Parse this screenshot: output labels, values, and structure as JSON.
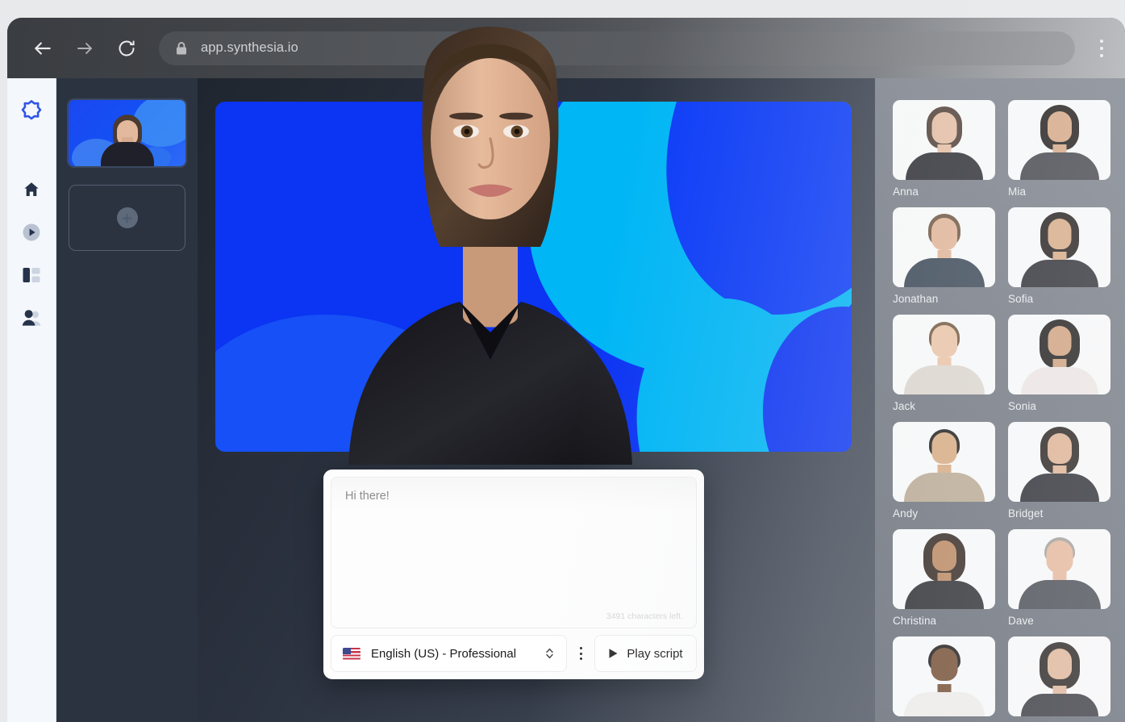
{
  "browser": {
    "url": "app.synthesia.io",
    "back_label": "Back",
    "forward_label": "Forward",
    "reload_label": "Reload",
    "menu_label": "Customize and control",
    "lock_icon": "lock-icon"
  },
  "rail": {
    "logo_name": "synthesia-logo",
    "items": [
      {
        "name": "home",
        "icon": "home-icon"
      },
      {
        "name": "videos",
        "icon": "play-circle-icon"
      },
      {
        "name": "templates",
        "icon": "layout-icon"
      },
      {
        "name": "avatars",
        "icon": "people-icon"
      }
    ]
  },
  "scenes": {
    "panel_name": "Scenes",
    "thumbnail_label": "Scene 1",
    "add_label": "Add scene",
    "add_icon": "plus-icon"
  },
  "canvas": {
    "name": "video-canvas",
    "background_color": "#0b34f3",
    "accent_color": "#00b6f5"
  },
  "script": {
    "text": "Hi there!",
    "placeholder": "Hi there!",
    "characters_left": "3491 characters left.",
    "language": "English (US) - Professional",
    "language_flag": "us-flag",
    "more_label": "More options",
    "play_label": "Play script",
    "play_icon": "play-icon",
    "selector_icon": "chevron-updown-icon"
  },
  "gallery": {
    "panel_name": "Avatars",
    "avatars": [
      {
        "name": "Anna",
        "hair": "#4a382e",
        "hair_w": 44,
        "hair_h": 52,
        "hair_t": 8,
        "face": "#e7bda0",
        "face_w": 31,
        "face_h": 39,
        "face_t": 15,
        "body": "#26262c",
        "body_w": 96,
        "body_h": 34,
        "style": "v-neck"
      },
      {
        "name": "Mia",
        "hair": "#15100d",
        "hair_w": 48,
        "hair_h": 56,
        "hair_t": 6,
        "face": "#d7a47e",
        "face_w": 30,
        "face_h": 38,
        "face_t": 14,
        "body": "#3b3b42",
        "body_w": 98,
        "body_h": 34,
        "style": "red-top"
      },
      {
        "name": "Jonathan",
        "hair": "#6a513c",
        "hair_w": 40,
        "hair_h": 40,
        "hair_t": 8,
        "face": "#e3b393",
        "face_w": 32,
        "face_h": 40,
        "face_t": 13,
        "body": "#33404f",
        "body_w": 100,
        "body_h": 36,
        "style": "white-tee"
      },
      {
        "name": "Sofia",
        "hair": "#191310",
        "hair_w": 48,
        "hair_h": 58,
        "hair_t": 6,
        "face": "#d8a87f",
        "face_w": 29,
        "face_h": 38,
        "face_t": 14,
        "body": "#232329",
        "body_w": 96,
        "body_h": 34,
        "style": "dark"
      },
      {
        "name": "Jack",
        "hair": "#6d5336",
        "hair_w": 38,
        "hair_h": 36,
        "hair_t": 9,
        "face": "#ecc3a3",
        "face_w": 32,
        "face_h": 40,
        "face_t": 13,
        "body": "#ddd6cd",
        "body_w": 100,
        "body_h": 36,
        "style": "light-tee"
      },
      {
        "name": "Sonia",
        "hair": "#130f0d",
        "hair_w": 50,
        "hair_h": 60,
        "hair_t": 6,
        "face": "#cf9d76",
        "face_w": 29,
        "face_h": 37,
        "face_t": 14,
        "body": "#efe7e4",
        "body_w": 96,
        "body_h": 34,
        "style": "white-shirt"
      },
      {
        "name": "Andy",
        "hair": "#151210",
        "hair_w": 38,
        "hair_h": 36,
        "hair_t": 9,
        "face": "#d9a87c",
        "face_w": 31,
        "face_h": 39,
        "face_t": 13,
        "body": "#b9a78f",
        "body_w": 100,
        "body_h": 36,
        "style": "blazer-dark"
      },
      {
        "name": "Bridget",
        "hair": "#1b1410",
        "hair_w": 48,
        "hair_h": 58,
        "hair_t": 6,
        "face": "#dfae8c",
        "face_w": 30,
        "face_h": 38,
        "face_t": 14,
        "body": "#1f1f26",
        "body_w": 98,
        "body_h": 35,
        "style": "dark"
      },
      {
        "name": "Christina",
        "hair": "#2b1d16",
        "hair_w": 52,
        "hair_h": 60,
        "hair_t": 5,
        "face": "#b98257",
        "face_w": 30,
        "face_h": 38,
        "face_t": 14,
        "body": "#232326",
        "body_w": 98,
        "body_h": 35,
        "style": "turtleneck"
      },
      {
        "name": "Dave",
        "hair": "#9d9a93",
        "hair_w": 38,
        "hair_h": 32,
        "hair_t": 10,
        "face": "#e7b596",
        "face_w": 33,
        "face_h": 40,
        "face_t": 14,
        "body": "#3c4046",
        "body_w": 102,
        "body_h": 36,
        "style": "suit"
      },
      {
        "name": "",
        "hair": "#120e0c",
        "hair_w": 40,
        "hair_h": 34,
        "hair_t": 10,
        "face": "#6e4527",
        "face_w": 33,
        "face_h": 41,
        "face_t": 14,
        "body": "#f0eeea",
        "body_w": 100,
        "body_h": 30,
        "style": "white-shirt"
      },
      {
        "name": "",
        "hair": "#1a1411",
        "hair_w": 50,
        "hair_h": 58,
        "hair_t": 7,
        "face": "#e0b392",
        "face_w": 30,
        "face_h": 38,
        "face_t": 15,
        "body": "#2a2a30",
        "body_w": 96,
        "body_h": 28,
        "style": "dark"
      }
    ]
  }
}
